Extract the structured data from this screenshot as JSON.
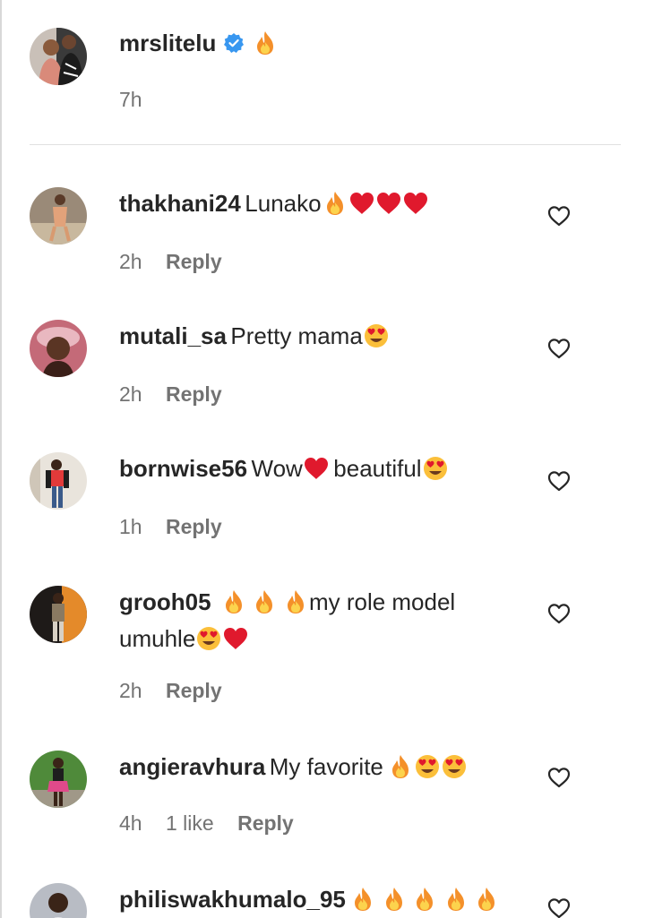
{
  "caption": {
    "username": "mrslitelu",
    "emoji": "fire",
    "time": "7h"
  },
  "comments": [
    {
      "username": "thakhani24",
      "text_before": "Lunako",
      "emojis": [
        "fire",
        "heart",
        "heart",
        "heart"
      ],
      "time": "2h",
      "likes": "",
      "reply": "Reply"
    },
    {
      "username": "mutali_sa",
      "text_before": "Pretty mama",
      "emojis": [
        "heart-eyes"
      ],
      "time": "2h",
      "likes": "",
      "reply": "Reply"
    },
    {
      "username": "bornwise56",
      "text_before": "Wow",
      "text_after": "beautiful",
      "time": "1h",
      "likes": "",
      "reply": "Reply"
    },
    {
      "username": "grooh05",
      "line1_text": "my role model",
      "line2_text": "umuhle",
      "time": "2h",
      "likes": "",
      "reply": "Reply"
    },
    {
      "username": "angieravhura",
      "text_before": "My favorite",
      "time": "4h",
      "likes": "1 like",
      "reply": "Reply"
    },
    {
      "username": "philiswakhumalo_95"
    }
  ],
  "colors": {
    "text": "#262626",
    "meta": "#737373",
    "verified": "#3897f0",
    "divider": "#e0e0e0"
  },
  "icons": {
    "like": "heart-outline-icon",
    "verified": "verified-badge-icon"
  }
}
